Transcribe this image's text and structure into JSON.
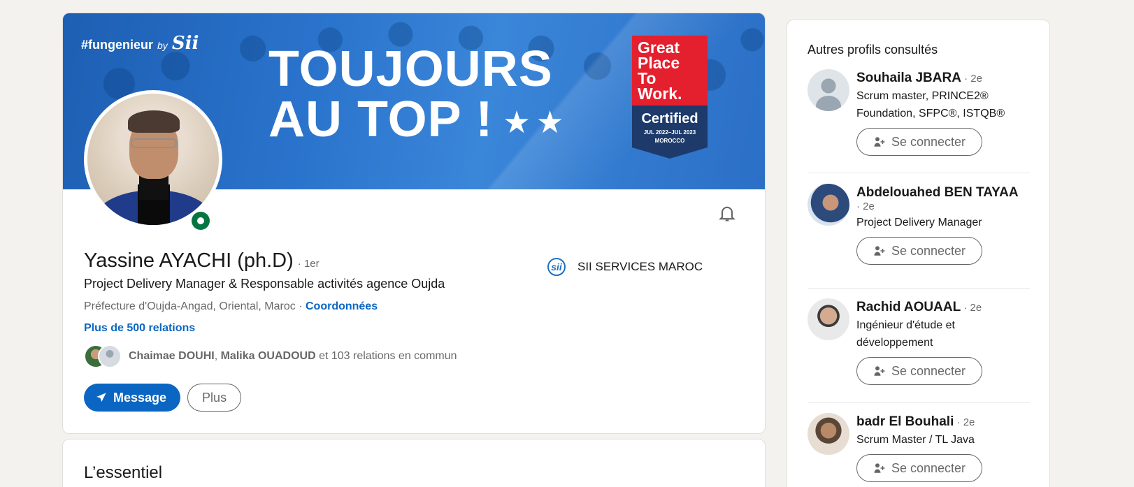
{
  "banner": {
    "tag": "#fungenieur",
    "tag_by": "by",
    "tag_logo": "Sii",
    "headline_line1": "TOUJOURS",
    "headline_line2": "AU TOP !",
    "stars": "★★",
    "badge": {
      "line1": "Great",
      "line2": "Place",
      "line3": "To",
      "line4": "Work.",
      "certified": "Certified",
      "dates": "JUL 2022–JUL 2023",
      "country": "MOROCCO"
    }
  },
  "profile": {
    "name": "Yassine AYACHI (ph.D)",
    "degree": "· 1er",
    "headline": "Project Delivery Manager & Responsable activités agence Oujda",
    "location": "Préfecture d'Oujda-Angad, Oriental, Maroc",
    "location_sep": " · ",
    "contact_link": "Coordonnées",
    "relations": "Plus de 500 relations",
    "mutual_name1": "Chaimae DOUHI",
    "mutual_sep": ", ",
    "mutual_name2": "Malika OUADOUD",
    "mutual_rest": " et 103 relations en commun",
    "company": "SII SERVICES MAROC",
    "message_label": "Message",
    "more_label": "Plus"
  },
  "essentiel": {
    "title": "L’essentiel"
  },
  "sidebar": {
    "title": "Autres profils consultés",
    "connect_label": "Se connecter",
    "people": [
      {
        "name": "Souhaila JBARA",
        "degree": " · 2e",
        "title": "Scrum master, PRINCE2® Foundation, SFPC®, ISTQB®"
      },
      {
        "name": "Abdelouahed BEN TAYAA",
        "degree": "· 2e",
        "title": "Project Delivery Manager"
      },
      {
        "name": "Rachid AOUAAL",
        "degree": " · 2e",
        "title": "Ingénieur d'étude et développement"
      },
      {
        "name": "badr El Bouhali",
        "degree": " · 2e",
        "title": "Scrum Master / TL Java"
      }
    ]
  },
  "colors": {
    "primary": "#0a66c2",
    "online": "#057642",
    "background": "#f4f2ee"
  }
}
